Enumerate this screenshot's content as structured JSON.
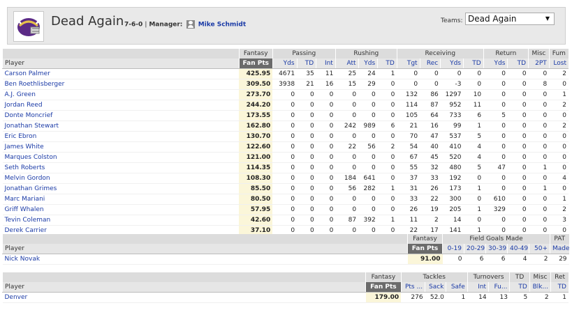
{
  "team": {
    "name": "Dead Again",
    "record": "7-6-0",
    "manager_label": "Manager:",
    "manager_name": "Mike Schmidt",
    "teams_label": "Teams:",
    "teams_selected": "Dead Again"
  },
  "offense": {
    "groups": [
      "Fantasy",
      "Passing",
      "Rushing",
      "Receiving",
      "Return",
      "Misc",
      "Fum"
    ],
    "columns": [
      "Player",
      "Fan Pts",
      "Yds",
      "TD",
      "Int",
      "Att",
      "Yds",
      "TD",
      "Tgt",
      "Rec",
      "Yds",
      "TD",
      "Yds",
      "TD",
      "2PT",
      "Lost"
    ],
    "rows": [
      [
        "Carson Palmer",
        "425.95",
        "4671",
        "35",
        "11",
        "25",
        "24",
        "1",
        "0",
        "0",
        "0",
        "0",
        "0",
        "0",
        "0",
        "2"
      ],
      [
        "Ben Roethlisberger",
        "309.50",
        "3938",
        "21",
        "16",
        "15",
        "29",
        "0",
        "0",
        "0",
        "-3",
        "0",
        "0",
        "0",
        "8",
        "0"
      ],
      [
        "A.J. Green",
        "273.70",
        "0",
        "0",
        "0",
        "0",
        "0",
        "0",
        "132",
        "86",
        "1297",
        "10",
        "0",
        "0",
        "0",
        "1"
      ],
      [
        "Jordan Reed",
        "244.20",
        "0",
        "0",
        "0",
        "0",
        "0",
        "0",
        "114",
        "87",
        "952",
        "11",
        "0",
        "0",
        "0",
        "2"
      ],
      [
        "Donte Moncrief",
        "173.55",
        "0",
        "0",
        "0",
        "0",
        "0",
        "0",
        "105",
        "64",
        "733",
        "6",
        "5",
        "0",
        "0",
        "0"
      ],
      [
        "Jonathan Stewart",
        "162.80",
        "0",
        "0",
        "0",
        "242",
        "989",
        "6",
        "21",
        "16",
        "99",
        "1",
        "0",
        "0",
        "0",
        "2"
      ],
      [
        "Eric Ebron",
        "130.70",
        "0",
        "0",
        "0",
        "0",
        "0",
        "0",
        "70",
        "47",
        "537",
        "5",
        "0",
        "0",
        "0",
        "0"
      ],
      [
        "James White",
        "122.60",
        "0",
        "0",
        "0",
        "22",
        "56",
        "2",
        "54",
        "40",
        "410",
        "4",
        "0",
        "0",
        "0",
        "0"
      ],
      [
        "Marques Colston",
        "121.00",
        "0",
        "0",
        "0",
        "0",
        "0",
        "0",
        "67",
        "45",
        "520",
        "4",
        "0",
        "0",
        "0",
        "0"
      ],
      [
        "Seth Roberts",
        "114.35",
        "0",
        "0",
        "0",
        "0",
        "0",
        "0",
        "55",
        "32",
        "480",
        "5",
        "47",
        "0",
        "1",
        "0"
      ],
      [
        "Melvin Gordon",
        "108.30",
        "0",
        "0",
        "0",
        "184",
        "641",
        "0",
        "37",
        "33",
        "192",
        "0",
        "0",
        "0",
        "0",
        "4"
      ],
      [
        "Jonathan Grimes",
        "85.50",
        "0",
        "0",
        "0",
        "56",
        "282",
        "1",
        "31",
        "26",
        "173",
        "1",
        "0",
        "0",
        "1",
        "0"
      ],
      [
        "Marc Mariani",
        "80.50",
        "0",
        "0",
        "0",
        "0",
        "0",
        "0",
        "33",
        "22",
        "300",
        "0",
        "610",
        "0",
        "0",
        "1"
      ],
      [
        "Griff Whalen",
        "57.95",
        "0",
        "0",
        "0",
        "0",
        "0",
        "0",
        "26",
        "19",
        "205",
        "1",
        "329",
        "0",
        "0",
        "2"
      ],
      [
        "Tevin Coleman",
        "42.60",
        "0",
        "0",
        "0",
        "87",
        "392",
        "1",
        "11",
        "2",
        "14",
        "0",
        "0",
        "0",
        "0",
        "3"
      ],
      [
        "Derek Carrier",
        "37.10",
        "0",
        "0",
        "0",
        "0",
        "0",
        "0",
        "22",
        "17",
        "141",
        "1",
        "0",
        "0",
        "0",
        "0"
      ]
    ]
  },
  "kicker": {
    "groups": [
      "Fantasy",
      "Field Goals Made",
      "PAT"
    ],
    "columns": [
      "Player",
      "Fan Pts",
      "0-19",
      "20-29",
      "30-39",
      "40-49",
      "50+",
      "Made"
    ],
    "rows": [
      [
        "Nick Novak",
        "91.00",
        "0",
        "6",
        "6",
        "4",
        "2",
        "29"
      ]
    ]
  },
  "defense": {
    "groups": [
      "Fantasy",
      "Tackles",
      "Turnovers",
      "TD",
      "Misc",
      "Ret"
    ],
    "columns": [
      "Player",
      "Fan Pts",
      "Pts ...",
      "Sack",
      "Safe",
      "Int",
      "Fu...",
      "TD",
      "Blk...",
      "TD"
    ],
    "rows": [
      [
        "Denver",
        "179.00",
        "276",
        "52.0",
        "1",
        "14",
        "13",
        "5",
        "2",
        "1"
      ]
    ]
  }
}
